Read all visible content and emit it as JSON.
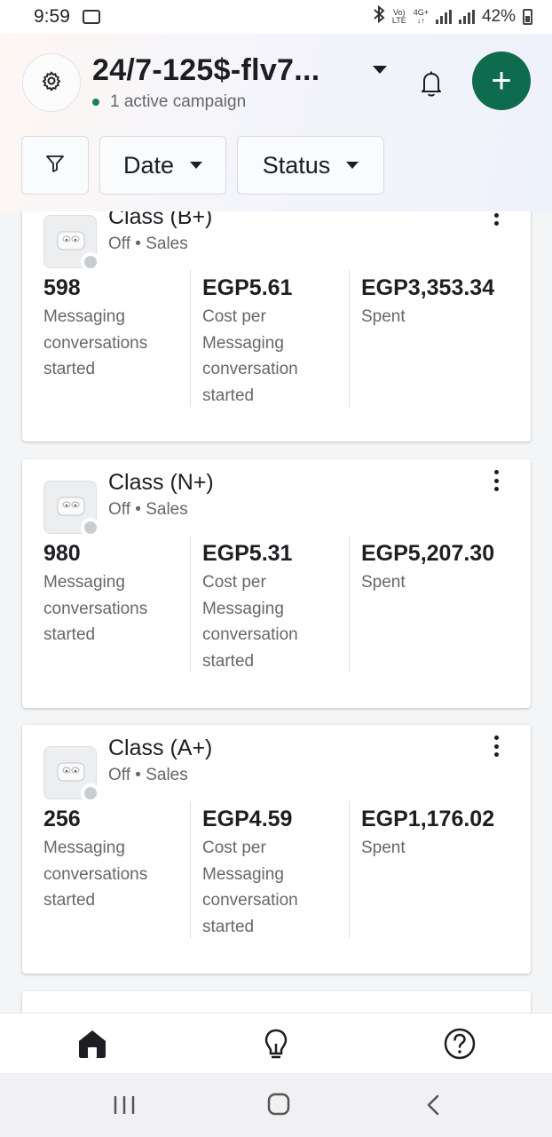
{
  "status_bar": {
    "time": "9:59",
    "network_top": "Vo)",
    "network_bottom": "LTE",
    "data_top": "4G+",
    "data_bottom": "↓↑",
    "battery": "42%"
  },
  "header": {
    "account_name": "24/7-125$-flv7...",
    "active_campaigns": "1 active campaign",
    "settings_icon": "gear-icon",
    "notification_icon": "bell-icon",
    "add_icon": "plus-icon",
    "add_symbol": "+",
    "accent_color": "#0f6b4d"
  },
  "filters": {
    "filter_icon": "funnel-icon",
    "date_label": "Date",
    "status_label": "Status"
  },
  "ads": [
    {
      "name": "Class (B+)",
      "status": "Off • Sales",
      "metrics": [
        {
          "value": "598",
          "label": "Messaging conversations started"
        },
        {
          "value": "EGP5.61",
          "label": "Cost per Messaging conversation started"
        },
        {
          "value": "EGP3,353.34",
          "label": "Spent"
        }
      ]
    },
    {
      "name": "Class (N+)",
      "status": "Off • Sales",
      "metrics": [
        {
          "value": "980",
          "label": "Messaging conversations started"
        },
        {
          "value": "EGP5.31",
          "label": "Cost per Messaging conversation started"
        },
        {
          "value": "EGP5,207.30",
          "label": "Spent"
        }
      ]
    },
    {
      "name": "Class (A+)",
      "status": "Off • Sales",
      "metrics": [
        {
          "value": "256",
          "label": "Messaging conversations started"
        },
        {
          "value": "EGP4.59",
          "label": "Cost per Messaging conversation started"
        },
        {
          "value": "EGP1,176.02",
          "label": "Spent"
        }
      ]
    }
  ],
  "bottom_nav": {
    "items": [
      "home-icon",
      "lightbulb-icon",
      "help-icon"
    ],
    "active": "home-icon"
  },
  "system_nav": {
    "items": [
      "recent-apps-icon",
      "home-circle-icon",
      "back-icon"
    ]
  }
}
